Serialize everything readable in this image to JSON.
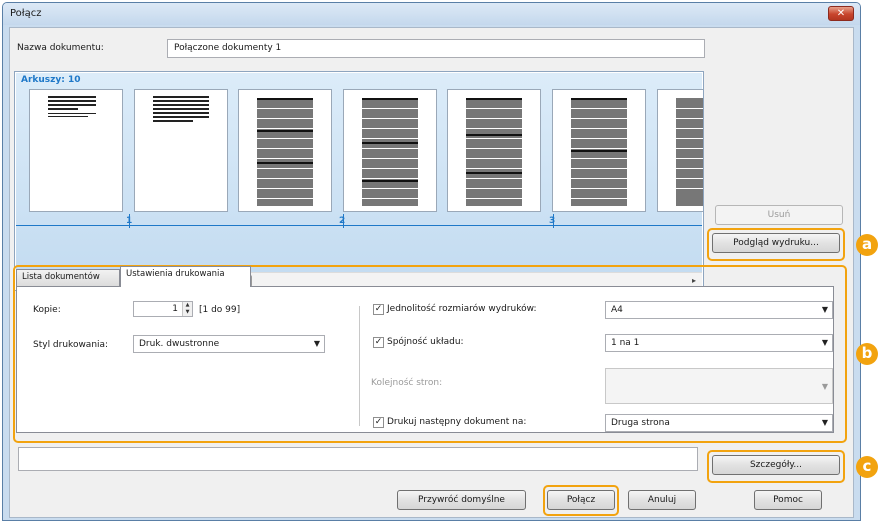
{
  "window": {
    "title": "Połącz",
    "close_label": "✕"
  },
  "document": {
    "name_label": "Nazwa dokumentu:",
    "name_value": "Połączone dokumenty 1"
  },
  "preview": {
    "sheets_label": "Arkuszy: 10",
    "page_numbers": [
      "1",
      "2",
      "3"
    ],
    "scroll_thumb": "|||"
  },
  "buttons": {
    "delete": "Usuń",
    "print_preview": "Podgląd wydruku...",
    "details": "Szczegóły...",
    "restore_defaults": "Przywróć domyślne",
    "combine": "Połącz",
    "cancel": "Anuluj",
    "help": "Pomoc"
  },
  "tabs": {
    "list": "Lista dokumentów",
    "print_settings": "Ustawienia drukowania"
  },
  "settings": {
    "copies_label": "Kopie:",
    "copies_value": "1",
    "copies_range": "[1 do 99]",
    "print_style_label": "Styl drukowania:",
    "print_style_value": "Druk. dwustronne",
    "uniform_paper_label": "Jednolitość rozmiarów wydruków:",
    "uniform_paper_value": "A4",
    "uniform_paper_checked": true,
    "layout_label": "Spójność układu:",
    "layout_value": "1 na 1",
    "layout_checked": true,
    "page_order_label": "Kolejność stron:",
    "page_order_value": "",
    "next_doc_label": "Drukuj następny dokument na:",
    "next_doc_value": "Druga strona",
    "next_doc_checked": true
  },
  "callouts": [
    "a",
    "b",
    "c"
  ],
  "colors": {
    "callout": "#f2a30f",
    "accent": "#1e78c8",
    "close": "#c8452d"
  }
}
